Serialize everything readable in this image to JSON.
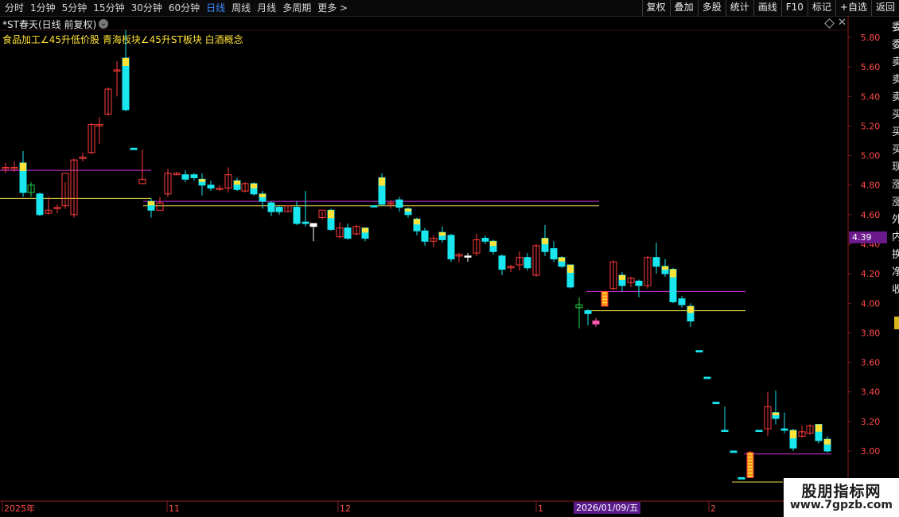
{
  "toolbar": {
    "periods": [
      "分时",
      "1分钟",
      "5分钟",
      "15分钟",
      "30分钟",
      "60分钟",
      "日线",
      "周线",
      "月线",
      "多周期",
      "更多 >"
    ],
    "active_period": "日线",
    "actions": [
      "复权",
      "叠加",
      "多股",
      "统计",
      "画线",
      "F10",
      "标记",
      "+自选",
      "返回"
    ]
  },
  "title": "*ST春天(日线 前复权)",
  "concepts": "食品加工∠45升低价股 青海板块∠45升ST板块 白酒概念",
  "current_price_tag": "4.39",
  "cursor_date_tag": "2026/01/09/五",
  "watermark": {
    "line1": "股朋指标网",
    "line2": "www.7gpzb.com"
  },
  "colors": {
    "up": "#ff3b3b",
    "down": "#19e6ee",
    "highlight": "#ffe23a",
    "magenta_line": "#cf2fd6",
    "yellow_line": "#f0e04a",
    "axis_text": "#ff4a4a",
    "bg": "#000000"
  },
  "chart_data": {
    "type": "candlestick",
    "y_axis_ticks": [
      "5.80",
      "5.60",
      "5.40",
      "5.20",
      "5.00",
      "4.80",
      "4.60",
      "4.40",
      "4.20",
      "4.00",
      "3.80",
      "3.60",
      "3.40",
      "3.20",
      "3.00"
    ],
    "ylim": [
      2.8,
      5.9
    ],
    "x_axis_labels": [
      "2025年",
      "11",
      "12",
      "1",
      "2"
    ],
    "candles": [
      {
        "o": 4.91,
        "h": 4.95,
        "l": 4.88,
        "c": 4.92,
        "t": "up"
      },
      {
        "o": 4.92,
        "h": 4.96,
        "l": 4.89,
        "c": 4.91,
        "t": "up"
      },
      {
        "o": 4.95,
        "h": 5.03,
        "l": 4.72,
        "c": 4.75,
        "t": "down"
      },
      {
        "o": 4.75,
        "h": 4.82,
        "l": 4.72,
        "c": 4.8,
        "t": "green"
      },
      {
        "o": 4.74,
        "h": 4.75,
        "l": 4.59,
        "c": 4.6,
        "t": "down"
      },
      {
        "o": 4.61,
        "h": 4.72,
        "l": 4.6,
        "c": 4.63,
        "t": "up"
      },
      {
        "o": 4.64,
        "h": 4.67,
        "l": 4.61,
        "c": 4.65,
        "t": "up"
      },
      {
        "o": 4.66,
        "h": 4.82,
        "l": 4.64,
        "c": 4.88,
        "t": "up"
      },
      {
        "o": 4.6,
        "h": 4.98,
        "l": 4.58,
        "c": 4.97,
        "t": "up"
      },
      {
        "o": 4.99,
        "h": 5.02,
        "l": 4.96,
        "c": 4.98,
        "t": "up"
      },
      {
        "o": 5.02,
        "h": 5.22,
        "l": 5.01,
        "c": 5.21,
        "t": "up"
      },
      {
        "o": 5.21,
        "h": 5.26,
        "l": 5.08,
        "c": 5.2,
        "t": "up"
      },
      {
        "o": 5.28,
        "h": 5.46,
        "l": 5.27,
        "c": 5.45,
        "t": "up"
      },
      {
        "o": 5.58,
        "h": 5.64,
        "l": 5.4,
        "c": 5.58,
        "t": "up"
      },
      {
        "o": 5.66,
        "h": 5.85,
        "l": 5.3,
        "c": 5.31,
        "t": "down"
      },
      {
        "o": 5.05,
        "h": 5.05,
        "l": 5.04,
        "c": 5.04,
        "t": "down"
      },
      {
        "o": 4.84,
        "h": 5.04,
        "l": 4.83,
        "c": 4.81,
        "t": "up"
      },
      {
        "o": 4.69,
        "h": 4.71,
        "l": 4.58,
        "c": 4.63,
        "t": "down"
      },
      {
        "o": 4.68,
        "h": 4.72,
        "l": 4.67,
        "c": 4.63,
        "t": "up"
      },
      {
        "o": 4.74,
        "h": 4.91,
        "l": 4.72,
        "c": 4.88,
        "t": "up"
      },
      {
        "o": 4.88,
        "h": 4.89,
        "l": 4.87,
        "c": 4.87,
        "t": "up"
      },
      {
        "o": 4.87,
        "h": 4.9,
        "l": 4.82,
        "c": 4.84,
        "t": "down"
      },
      {
        "o": 4.87,
        "h": 4.88,
        "l": 4.83,
        "c": 4.85,
        "t": "down"
      },
      {
        "o": 4.84,
        "h": 4.88,
        "l": 4.73,
        "c": 4.8,
        "t": "down"
      },
      {
        "o": 4.8,
        "h": 4.83,
        "l": 4.76,
        "c": 4.78,
        "t": "down"
      },
      {
        "o": 4.77,
        "h": 4.8,
        "l": 4.76,
        "c": 4.78,
        "t": "up"
      },
      {
        "o": 4.78,
        "h": 4.92,
        "l": 4.75,
        "c": 4.87,
        "t": "up"
      },
      {
        "o": 4.83,
        "h": 4.85,
        "l": 4.76,
        "c": 4.77,
        "t": "down"
      },
      {
        "o": 4.76,
        "h": 4.82,
        "l": 4.75,
        "c": 4.81,
        "t": "up"
      },
      {
        "o": 4.81,
        "h": 4.82,
        "l": 4.73,
        "c": 4.74,
        "t": "down"
      },
      {
        "o": 4.74,
        "h": 4.76,
        "l": 4.64,
        "c": 4.69,
        "t": "down"
      },
      {
        "o": 4.68,
        "h": 4.69,
        "l": 4.59,
        "c": 4.62,
        "t": "down"
      },
      {
        "o": 4.65,
        "h": 4.66,
        "l": 4.6,
        "c": 4.62,
        "t": "down"
      },
      {
        "o": 4.62,
        "h": 4.66,
        "l": 4.62,
        "c": 4.66,
        "t": "up"
      },
      {
        "o": 4.65,
        "h": 4.69,
        "l": 4.53,
        "c": 4.54,
        "t": "down"
      },
      {
        "o": 4.55,
        "h": 4.76,
        "l": 4.52,
        "c": 4.54,
        "t": "down"
      },
      {
        "o": 4.54,
        "h": 4.54,
        "l": 4.42,
        "c": 4.52,
        "t": "wick"
      },
      {
        "o": 4.58,
        "h": 4.62,
        "l": 4.57,
        "c": 4.63,
        "t": "up"
      },
      {
        "o": 4.63,
        "h": 4.64,
        "l": 4.49,
        "c": 4.5,
        "t": "down"
      },
      {
        "o": 4.45,
        "h": 4.55,
        "l": 4.44,
        "c": 4.51,
        "t": "up"
      },
      {
        "o": 4.51,
        "h": 4.54,
        "l": 4.43,
        "c": 4.44,
        "t": "down"
      },
      {
        "o": 4.47,
        "h": 4.53,
        "l": 4.46,
        "c": 4.52,
        "t": "up"
      },
      {
        "o": 4.51,
        "h": 4.51,
        "l": 4.42,
        "c": 4.44,
        "t": "down"
      },
      {
        "o": 4.66,
        "h": 4.66,
        "l": 4.65,
        "c": 4.66,
        "t": "down"
      },
      {
        "o": 4.85,
        "h": 4.88,
        "l": 4.66,
        "c": 4.67,
        "t": "down"
      },
      {
        "o": 4.67,
        "h": 4.7,
        "l": 4.64,
        "c": 4.68,
        "t": "up"
      },
      {
        "o": 4.7,
        "h": 4.72,
        "l": 4.62,
        "c": 4.65,
        "t": "down"
      },
      {
        "o": 4.64,
        "h": 4.65,
        "l": 4.58,
        "c": 4.6,
        "t": "down"
      },
      {
        "o": 4.57,
        "h": 4.58,
        "l": 4.46,
        "c": 4.49,
        "t": "down"
      },
      {
        "o": 4.49,
        "h": 4.51,
        "l": 4.39,
        "c": 4.42,
        "t": "down"
      },
      {
        "o": 4.42,
        "h": 4.46,
        "l": 4.38,
        "c": 4.44,
        "t": "up"
      },
      {
        "o": 4.48,
        "h": 4.52,
        "l": 4.41,
        "c": 4.43,
        "t": "down"
      },
      {
        "o": 4.46,
        "h": 4.47,
        "l": 4.28,
        "c": 4.3,
        "t": "down"
      },
      {
        "o": 4.33,
        "h": 4.34,
        "l": 4.28,
        "c": 4.32,
        "t": "up"
      },
      {
        "o": 4.32,
        "h": 4.34,
        "l": 4.28,
        "c": 4.32,
        "t": "wick"
      },
      {
        "o": 4.34,
        "h": 4.47,
        "l": 4.32,
        "c": 4.43,
        "t": "up"
      },
      {
        "o": 4.44,
        "h": 4.46,
        "l": 4.4,
        "c": 4.42,
        "t": "down"
      },
      {
        "o": 4.42,
        "h": 4.43,
        "l": 4.33,
        "c": 4.35,
        "t": "down"
      },
      {
        "o": 4.32,
        "h": 4.33,
        "l": 4.19,
        "c": 4.23,
        "t": "down"
      },
      {
        "o": 4.24,
        "h": 4.26,
        "l": 4.21,
        "c": 4.25,
        "t": "up"
      },
      {
        "o": 4.26,
        "h": 4.35,
        "l": 4.22,
        "c": 4.31,
        "t": "up"
      },
      {
        "o": 4.31,
        "h": 4.34,
        "l": 4.22,
        "c": 4.24,
        "t": "down"
      },
      {
        "o": 4.19,
        "h": 4.4,
        "l": 4.18,
        "c": 4.39,
        "t": "up"
      },
      {
        "o": 4.44,
        "h": 4.53,
        "l": 4.32,
        "c": 4.35,
        "t": "down"
      },
      {
        "o": 4.37,
        "h": 4.42,
        "l": 4.28,
        "c": 4.3,
        "t": "down"
      },
      {
        "o": 4.31,
        "h": 4.32,
        "l": 4.24,
        "c": 4.25,
        "t": "down"
      },
      {
        "o": 4.26,
        "h": 4.26,
        "l": 4.1,
        "c": 4.11,
        "t": "down"
      },
      {
        "o": 3.97,
        "h": 4.04,
        "l": 3.83,
        "c": 3.99,
        "t": "green"
      },
      {
        "o": 3.95,
        "h": 3.96,
        "l": 3.85,
        "c": 3.93,
        "t": "down"
      },
      {
        "o": 3.88,
        "h": 3.9,
        "l": 3.84,
        "c": 3.86,
        "t": "pink"
      },
      {
        "o": 4.08,
        "h": 4.08,
        "l": 3.98,
        "c": 3.98,
        "t": "yellowbar"
      },
      {
        "o": 4.1,
        "h": 4.29,
        "l": 4.09,
        "c": 4.28,
        "t": "up"
      },
      {
        "o": 4.19,
        "h": 4.21,
        "l": 4.08,
        "c": 4.12,
        "t": "down"
      },
      {
        "o": 4.14,
        "h": 4.18,
        "l": 4.11,
        "c": 4.17,
        "t": "up"
      },
      {
        "o": 4.15,
        "h": 4.16,
        "l": 4.04,
        "c": 4.12,
        "t": "down"
      },
      {
        "o": 4.12,
        "h": 4.32,
        "l": 4.1,
        "c": 4.31,
        "t": "up"
      },
      {
        "o": 4.31,
        "h": 4.41,
        "l": 4.2,
        "c": 4.25,
        "t": "down"
      },
      {
        "o": 4.25,
        "h": 4.3,
        "l": 4.18,
        "c": 4.2,
        "t": "down"
      },
      {
        "o": 4.23,
        "h": 4.24,
        "l": 4.0,
        "c": 4.01,
        "t": "down"
      },
      {
        "o": 4.03,
        "h": 4.05,
        "l": 3.97,
        "c": 3.99,
        "t": "down"
      },
      {
        "o": 3.98,
        "h": 4.0,
        "l": 3.84,
        "c": 3.88,
        "t": "down"
      },
      {
        "o": 3.68,
        "h": 3.68,
        "l": 3.67,
        "c": 3.67,
        "t": "down"
      },
      {
        "o": 3.5,
        "h": 3.5,
        "l": 3.49,
        "c": 3.49,
        "t": "down"
      },
      {
        "o": 3.33,
        "h": 3.33,
        "l": 3.32,
        "c": 3.32,
        "t": "down"
      },
      {
        "o": 3.14,
        "h": 3.3,
        "l": 3.14,
        "c": 3.14,
        "t": "down"
      },
      {
        "o": 3.0,
        "h": 3.0,
        "l": 2.99,
        "c": 2.99,
        "t": "down"
      },
      {
        "o": 2.82,
        "h": 2.82,
        "l": 2.81,
        "c": 2.81,
        "t": "down"
      },
      {
        "o": 2.82,
        "h": 3.0,
        "l": 2.82,
        "c": 2.99,
        "t": "yellowbar"
      },
      {
        "o": 3.14,
        "h": 3.14,
        "l": 3.13,
        "c": 3.14,
        "t": "down"
      },
      {
        "o": 3.15,
        "h": 3.4,
        "l": 3.1,
        "c": 3.3,
        "t": "up"
      },
      {
        "o": 3.26,
        "h": 3.41,
        "l": 3.18,
        "c": 3.22,
        "t": "down"
      },
      {
        "o": 3.15,
        "h": 3.26,
        "l": 3.12,
        "c": 3.14,
        "t": "down"
      },
      {
        "o": 3.14,
        "h": 3.15,
        "l": 3.0,
        "c": 3.02,
        "t": "down"
      },
      {
        "o": 3.1,
        "h": 3.17,
        "l": 3.09,
        "c": 3.13,
        "t": "up"
      },
      {
        "o": 3.12,
        "h": 3.18,
        "l": 3.11,
        "c": 3.17,
        "t": "up"
      },
      {
        "o": 3.18,
        "h": 3.18,
        "l": 3.05,
        "c": 3.07,
        "t": "down"
      },
      {
        "o": 3.08,
        "h": 3.1,
        "l": 2.99,
        "c": 3.0,
        "t": "down"
      }
    ],
    "h_lines": [
      {
        "price": 4.9,
        "x0": 0,
        "x1": 190,
        "color": "magenta"
      },
      {
        "price": 4.71,
        "x0": 0,
        "x1": 190,
        "color": "yellow"
      },
      {
        "price": 4.69,
        "x0": 180,
        "x1": 753,
        "color": "magenta"
      },
      {
        "price": 4.66,
        "x0": 180,
        "x1": 753,
        "color": "yellow"
      },
      {
        "price": 4.08,
        "x0": 737,
        "x1": 937,
        "color": "magenta"
      },
      {
        "price": 3.95,
        "x0": 737,
        "x1": 937,
        "color": "yellow"
      },
      {
        "price": 2.98,
        "x0": 935,
        "x1": 1045,
        "color": "magenta"
      },
      {
        "price": 2.79,
        "x0": 920,
        "x1": 984,
        "color": "yellow"
      }
    ]
  }
}
